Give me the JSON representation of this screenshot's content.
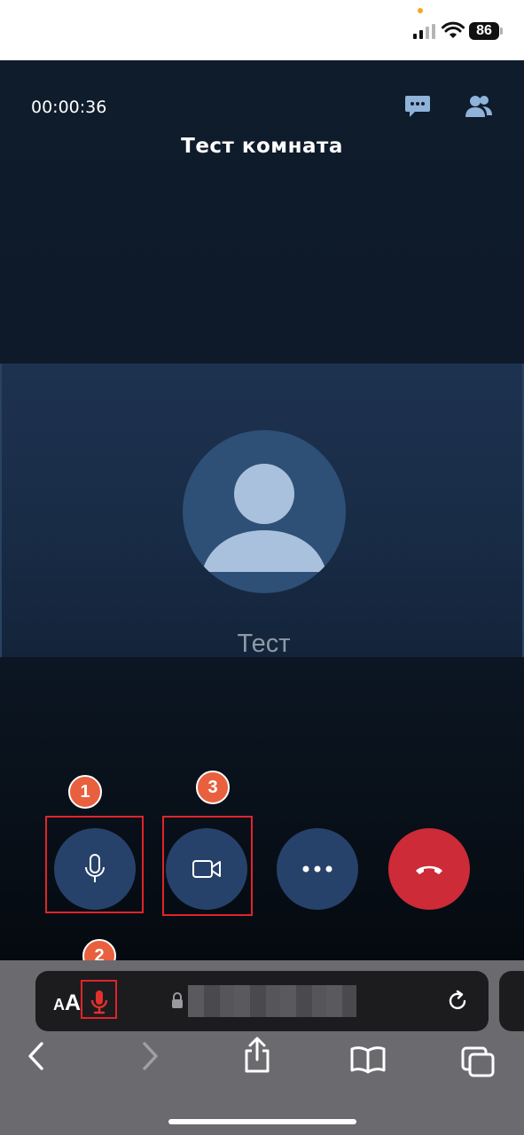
{
  "status_bar": {
    "battery_level": "86",
    "privacy_dot_color": "#f5a623"
  },
  "call": {
    "timer": "00:00:36",
    "room_title": "Тест комната",
    "participant_name": "Тест",
    "icons": {
      "chat": "chat-bubble-icon",
      "participants": "participants-icon"
    },
    "controls": [
      {
        "name": "microphone",
        "icon": "microphone-icon"
      },
      {
        "name": "camera",
        "icon": "video-camera-icon"
      },
      {
        "name": "more",
        "icon": "ellipsis-icon"
      },
      {
        "name": "hang-up",
        "icon": "hang-up-icon",
        "color": "#cc2b37"
      }
    ]
  },
  "annotations": {
    "badge_1": "1",
    "badge_2": "2",
    "badge_3": "3",
    "highlight_color": "#e0242b",
    "badge_color": "#e8603e"
  },
  "browser": {
    "text_size_small": "A",
    "text_size_big": "A",
    "url": "",
    "nav": [
      "back",
      "forward",
      "share",
      "bookmarks",
      "tabs"
    ]
  }
}
